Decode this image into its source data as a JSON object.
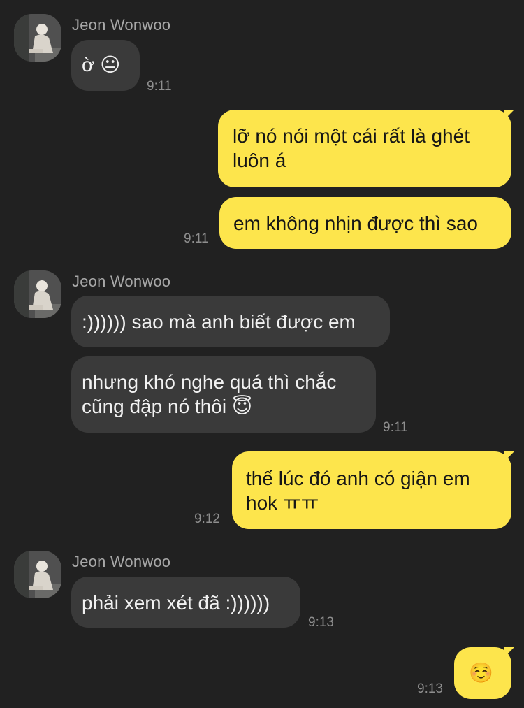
{
  "chat": {
    "sender_name": "Jeon Wonwoo",
    "messages": [
      {
        "from": "in",
        "text": "ờ 😐"
      },
      {
        "time": "9:11"
      },
      {
        "from": "out",
        "text": "lỡ nó nói một cái rất là ghét\nluôn á"
      },
      {
        "from": "out",
        "text": "em không nhịn được thì sao"
      },
      {
        "time": "9:11"
      },
      {
        "from": "in",
        "text": ":)))))) sao mà anh biết được em"
      },
      {
        "from": "in",
        "text": "nhưng khó nghe quá thì chắc\ncũng đập nó thôi 😇"
      },
      {
        "time": "9:11"
      },
      {
        "from": "out",
        "text": "thế lúc đó anh có giận em\nhok ㅠㅠ"
      },
      {
        "time": "9:12"
      },
      {
        "from": "in",
        "text": "phải xem xét đã :))))))"
      },
      {
        "time": "9:13"
      },
      {
        "from": "out",
        "text": "☺️"
      },
      {
        "time": "9:13"
      }
    ]
  },
  "colors": {
    "background": "#212121",
    "incoming_bubble": "#3a3a3a",
    "outgoing_bubble": "#fde54c"
  }
}
